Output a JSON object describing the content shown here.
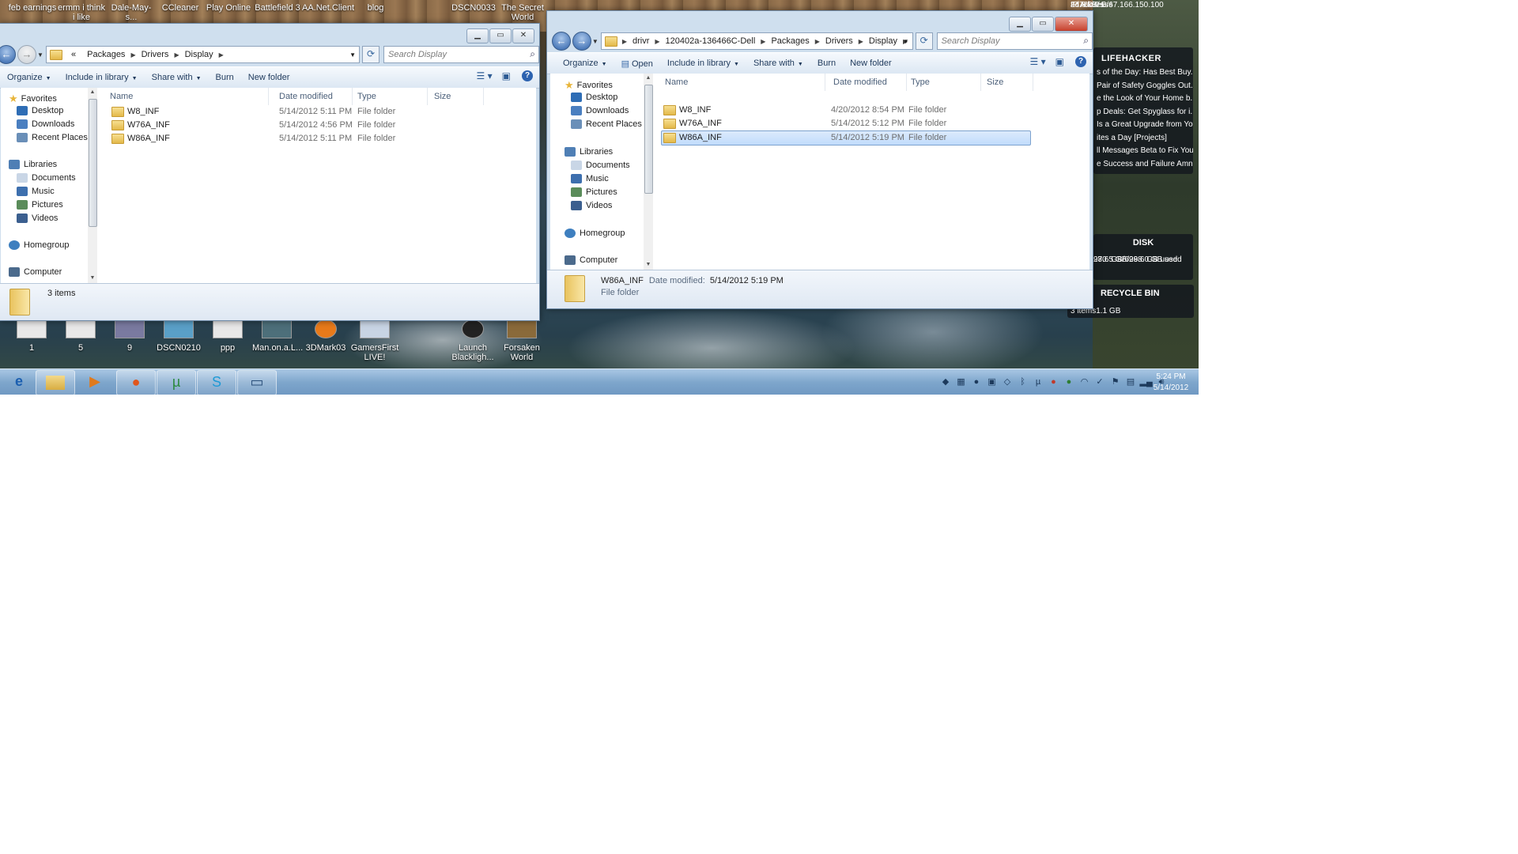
{
  "desktop": {
    "top_icons": [
      "feb earnings",
      "ermm i think i like socce...",
      "Dale-May-s...",
      "CCleaner",
      "Play Online",
      "Battlefield 3",
      "AA.Net.Client",
      "blog",
      "DSCN0033",
      "The Secret World"
    ],
    "bottom_icons": [
      "1",
      "5",
      "9",
      "DSCN0210",
      "ppp",
      "Man.on.a.L...",
      "3DMark03",
      "GamersFirst LIVE!",
      "Launch Blackligh...",
      "Forsaken World"
    ]
  },
  "gadgets": {
    "network": {
      "ip_label": "IP Address",
      "ip_value": "67.166.150.100",
      "speed1": "24.8 kB/s",
      "ad_label": "ad",
      "speed2": "760.0 B/s"
    },
    "lifehacker": {
      "title": "LIFEHACKER",
      "items": [
        "s of the Day: Has Best Buy...",
        "Pair of Safety Goggles Out...",
        "e the Look of Your Home b...",
        "p Deals: Get Spyglass for i...",
        "Is a Great Upgrade from Yo...",
        "ites a Day [Projects]",
        "ll Messages Beta to Fix You...",
        "e Success and Failure Amn..."
      ]
    },
    "disk": {
      "title": "DISK",
      "rows": [
        "270.5 GB/298.0 GB used",
        "98.6 GB/698.6 GB used"
      ]
    },
    "recycle": {
      "title": "RECYCLE BIN",
      "items": "3 items",
      "size": "1.1 GB"
    }
  },
  "window_left": {
    "address": {
      "prefix": "«",
      "segments": [
        "Packages",
        "Drivers",
        "Display"
      ]
    },
    "search_placeholder": "Search Display",
    "commands": {
      "organize": "Organize",
      "include": "Include in library",
      "share": "Share with",
      "burn": "Burn",
      "new_folder": "New folder"
    },
    "nav": {
      "favorites": "Favorites",
      "desktop": "Desktop",
      "downloads": "Downloads",
      "recent": "Recent Places",
      "libraries": "Libraries",
      "documents": "Documents",
      "music": "Music",
      "pictures": "Pictures",
      "videos": "Videos",
      "homegroup": "Homegroup",
      "computer": "Computer"
    },
    "columns": {
      "name": "Name",
      "date": "Date modified",
      "type": "Type",
      "size": "Size"
    },
    "files": [
      {
        "name": "W8_INF",
        "date": "5/14/2012 5:11 PM",
        "type": "File folder"
      },
      {
        "name": "W76A_INF",
        "date": "5/14/2012 4:56 PM",
        "type": "File folder"
      },
      {
        "name": "W86A_INF",
        "date": "5/14/2012 5:11 PM",
        "type": "File folder"
      }
    ],
    "status": "3 items"
  },
  "window_right": {
    "address": {
      "segments": [
        "drivr",
        "120402a-136466C-Dell",
        "Packages",
        "Drivers",
        "Display"
      ]
    },
    "search_placeholder": "Search Display",
    "commands": {
      "organize": "Organize",
      "open": "Open",
      "include": "Include in library",
      "share": "Share with",
      "burn": "Burn",
      "new_folder": "New folder"
    },
    "nav": {
      "favorites": "Favorites",
      "desktop": "Desktop",
      "downloads": "Downloads",
      "recent": "Recent Places",
      "libraries": "Libraries",
      "documents": "Documents",
      "music": "Music",
      "pictures": "Pictures",
      "videos": "Videos",
      "homegroup": "Homegroup",
      "computer": "Computer"
    },
    "columns": {
      "name": "Name",
      "date": "Date modified",
      "type": "Type",
      "size": "Size"
    },
    "files": [
      {
        "name": "W8_INF",
        "date": "4/20/2012 8:54 PM",
        "type": "File folder"
      },
      {
        "name": "W76A_INF",
        "date": "5/14/2012 5:12 PM",
        "type": "File folder"
      },
      {
        "name": "W86A_INF",
        "date": "5/14/2012 5:19 PM",
        "type": "File folder",
        "selected": true
      }
    ],
    "details": {
      "name": "W86A_INF",
      "date_label": "Date modified:",
      "date_value": "5/14/2012 5:19 PM",
      "type": "File folder"
    }
  },
  "taskbar": {
    "time": "5:24 PM",
    "date": "5/14/2012"
  }
}
